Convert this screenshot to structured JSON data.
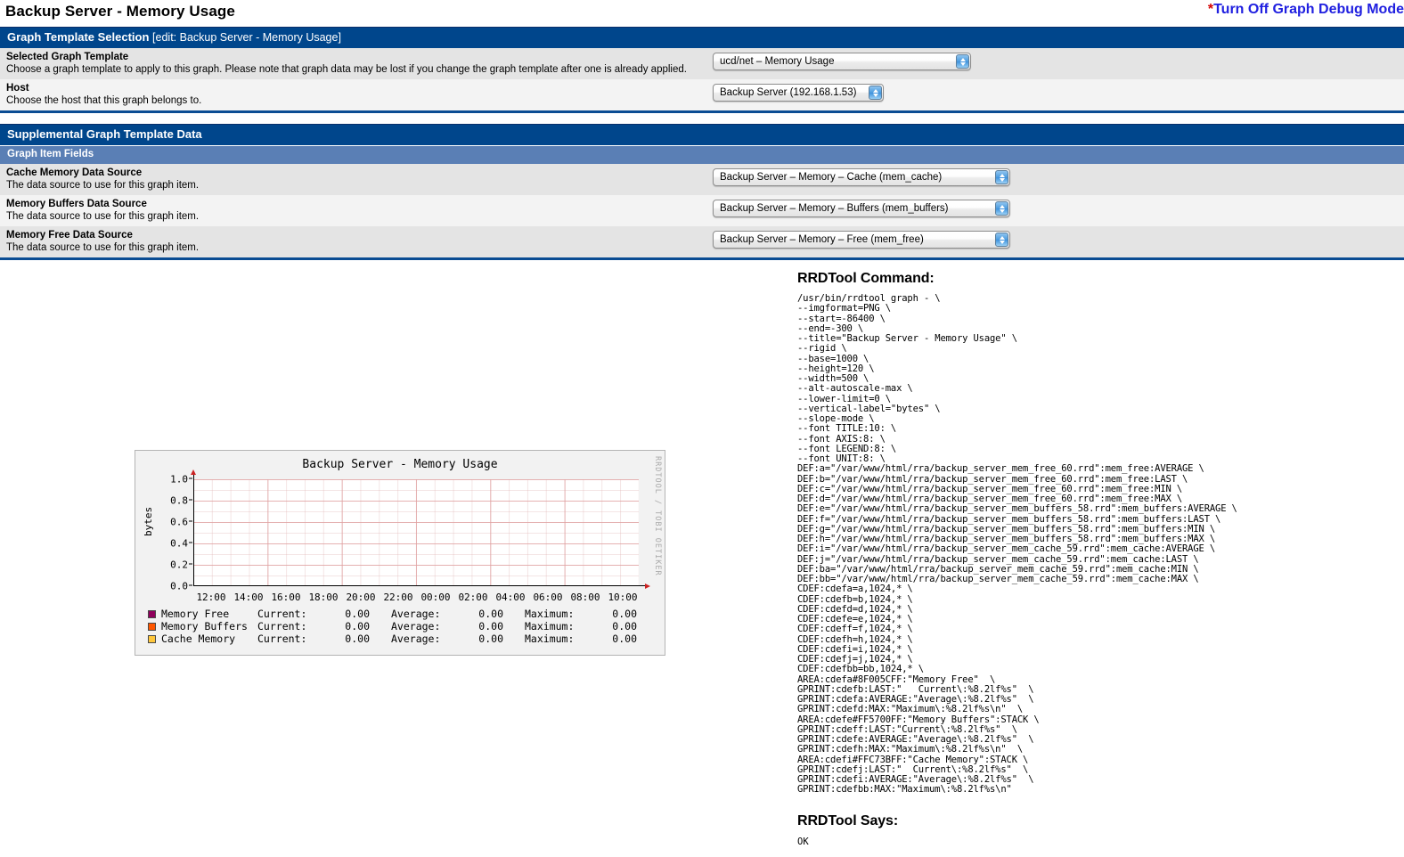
{
  "header": {
    "title": "Backup Server - Memory Usage",
    "debug_link_star": "*",
    "debug_link_label": "Turn Off Graph Debug Mode"
  },
  "graph_template_selection": {
    "box_title": "Graph Template Selection",
    "box_subtitle": "[edit: Backup Server - Memory Usage]",
    "fields": [
      {
        "label": "Selected Graph Template",
        "desc": "Choose a graph template to apply to this graph. Please note that graph data may be lost if you change the graph template after one is already applied.",
        "value": "ucd/net – Memory Usage"
      },
      {
        "label": "Host",
        "desc": "Choose the host that this graph belongs to.",
        "value": "Backup Server (192.168.1.53)"
      }
    ]
  },
  "supplemental": {
    "box_title": "Supplemental Graph Template Data",
    "sub_header": "Graph Item Fields",
    "fields": [
      {
        "label": "Cache Memory Data Source",
        "desc": "The data source to use for this graph item.",
        "value": "Backup Server – Memory – Cache (mem_cache)"
      },
      {
        "label": "Memory Buffers Data Source",
        "desc": "The data source to use for this graph item.",
        "value": "Backup Server – Memory – Buffers (mem_buffers)"
      },
      {
        "label": "Memory Free Data Source",
        "desc": "The data source to use for this graph item.",
        "value": "Backup Server – Memory – Free (mem_free)"
      }
    ]
  },
  "rrdtool": {
    "command_heading": "RRDTool Command:",
    "command": "/usr/bin/rrdtool graph - \\\n--imgformat=PNG \\\n--start=-86400 \\\n--end=-300 \\\n--title=\"Backup Server - Memory Usage\" \\\n--rigid \\\n--base=1000 \\\n--height=120 \\\n--width=500 \\\n--alt-autoscale-max \\\n--lower-limit=0 \\\n--vertical-label=\"bytes\" \\\n--slope-mode \\\n--font TITLE:10: \\\n--font AXIS:8: \\\n--font LEGEND:8: \\\n--font UNIT:8: \\\nDEF:a=\"/var/www/html/rra/backup_server_mem_free_60.rrd\":mem_free:AVERAGE \\\nDEF:b=\"/var/www/html/rra/backup_server_mem_free_60.rrd\":mem_free:LAST \\\nDEF:c=\"/var/www/html/rra/backup_server_mem_free_60.rrd\":mem_free:MIN \\\nDEF:d=\"/var/www/html/rra/backup_server_mem_free_60.rrd\":mem_free:MAX \\\nDEF:e=\"/var/www/html/rra/backup_server_mem_buffers_58.rrd\":mem_buffers:AVERAGE \\\nDEF:f=\"/var/www/html/rra/backup_server_mem_buffers_58.rrd\":mem_buffers:LAST \\\nDEF:g=\"/var/www/html/rra/backup_server_mem_buffers_58.rrd\":mem_buffers:MIN \\\nDEF:h=\"/var/www/html/rra/backup_server_mem_buffers_58.rrd\":mem_buffers:MAX \\\nDEF:i=\"/var/www/html/rra/backup_server_mem_cache_59.rrd\":mem_cache:AVERAGE \\\nDEF:j=\"/var/www/html/rra/backup_server_mem_cache_59.rrd\":mem_cache:LAST \\\nDEF:ba=\"/var/www/html/rra/backup_server_mem_cache_59.rrd\":mem_cache:MIN \\\nDEF:bb=\"/var/www/html/rra/backup_server_mem_cache_59.rrd\":mem_cache:MAX \\\nCDEF:cdefa=a,1024,* \\\nCDEF:cdefb=b,1024,* \\\nCDEF:cdefd=d,1024,* \\\nCDEF:cdefe=e,1024,* \\\nCDEF:cdeff=f,1024,* \\\nCDEF:cdefh=h,1024,* \\\nCDEF:cdefi=i,1024,* \\\nCDEF:cdefj=j,1024,* \\\nCDEF:cdefbb=bb,1024,* \\\nAREA:cdefa#8F005CFF:\"Memory Free\"  \\\nGPRINT:cdefb:LAST:\"   Current\\:%8.2lf%s\"  \\\nGPRINT:cdefa:AVERAGE:\"Average\\:%8.2lf%s\"  \\\nGPRINT:cdefd:MAX:\"Maximum\\:%8.2lf%s\\n\"  \\\nAREA:cdefe#FF5700FF:\"Memory Buffers\":STACK \\\nGPRINT:cdeff:LAST:\"Current\\:%8.2lf%s\"  \\\nGPRINT:cdefe:AVERAGE:\"Average\\:%8.2lf%s\"  \\\nGPRINT:cdefh:MAX:\"Maximum\\:%8.2lf%s\\n\"  \\\nAREA:cdefi#FFC73BFF:\"Cache Memory\":STACK \\\nGPRINT:cdefj:LAST:\"  Current\\:%8.2lf%s\"  \\\nGPRINT:cdefi:AVERAGE:\"Average\\:%8.2lf%s\"  \\\nGPRINT:cdefbb:MAX:\"Maximum\\:%8.2lf%s\\n\"",
    "says_heading": "RRDTool Says:",
    "says_body": "OK"
  },
  "chart_data": {
    "type": "area",
    "title": "Backup Server - Memory Usage",
    "xlabel": "",
    "ylabel": "bytes",
    "watermark": "RRDTOOL / TOBI OETIKER",
    "grid": true,
    "legend_position": "below",
    "ylim": [
      0.0,
      1.0
    ],
    "yticks": [
      "0.0",
      "0.2",
      "0.4",
      "0.6",
      "0.8",
      "1.0"
    ],
    "ytick_values": [
      0.0,
      0.2,
      0.4,
      0.6,
      0.8,
      1.0
    ],
    "categories": [
      "12:00",
      "14:00",
      "16:00",
      "18:00",
      "20:00",
      "22:00",
      "00:00",
      "02:00",
      "04:00",
      "06:00",
      "08:00",
      "10:00"
    ],
    "series": [
      {
        "name": "Memory Free",
        "color": "#8F005C",
        "values": [
          0,
          0,
          0,
          0,
          0,
          0,
          0,
          0,
          0,
          0,
          0,
          0
        ],
        "stats": {
          "Current": "0.00",
          "Average": "0.00",
          "Maximum": "0.00"
        }
      },
      {
        "name": "Memory Buffers",
        "color": "#FF5700",
        "values": [
          0,
          0,
          0,
          0,
          0,
          0,
          0,
          0,
          0,
          0,
          0,
          0
        ],
        "stats": {
          "Current": "0.00",
          "Average": "0.00",
          "Maximum": "0.00"
        }
      },
      {
        "name": "Cache Memory",
        "color": "#FFC73B",
        "values": [
          0,
          0,
          0,
          0,
          0,
          0,
          0,
          0,
          0,
          0,
          0,
          0
        ],
        "stats": {
          "Current": "0.00",
          "Average": "0.00",
          "Maximum": "0.00"
        }
      }
    ],
    "legend_labels": {
      "current": "Current:",
      "average": "Average:",
      "maximum": "Maximum:"
    }
  }
}
